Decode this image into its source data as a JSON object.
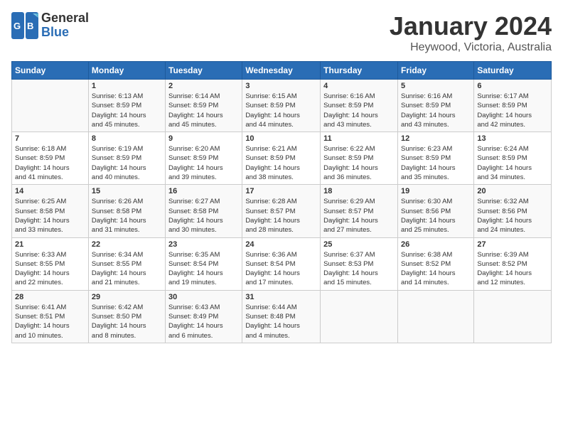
{
  "header": {
    "logo_line1": "General",
    "logo_line2": "Blue",
    "title": "January 2024",
    "subtitle": "Heywood, Victoria, Australia"
  },
  "days_of_week": [
    "Sunday",
    "Monday",
    "Tuesday",
    "Wednesday",
    "Thursday",
    "Friday",
    "Saturday"
  ],
  "weeks": [
    [
      {
        "day": "",
        "info": ""
      },
      {
        "day": "1",
        "info": "Sunrise: 6:13 AM\nSunset: 8:59 PM\nDaylight: 14 hours\nand 45 minutes."
      },
      {
        "day": "2",
        "info": "Sunrise: 6:14 AM\nSunset: 8:59 PM\nDaylight: 14 hours\nand 45 minutes."
      },
      {
        "day": "3",
        "info": "Sunrise: 6:15 AM\nSunset: 8:59 PM\nDaylight: 14 hours\nand 44 minutes."
      },
      {
        "day": "4",
        "info": "Sunrise: 6:16 AM\nSunset: 8:59 PM\nDaylight: 14 hours\nand 43 minutes."
      },
      {
        "day": "5",
        "info": "Sunrise: 6:16 AM\nSunset: 8:59 PM\nDaylight: 14 hours\nand 43 minutes."
      },
      {
        "day": "6",
        "info": "Sunrise: 6:17 AM\nSunset: 8:59 PM\nDaylight: 14 hours\nand 42 minutes."
      }
    ],
    [
      {
        "day": "7",
        "info": "Sunrise: 6:18 AM\nSunset: 8:59 PM\nDaylight: 14 hours\nand 41 minutes."
      },
      {
        "day": "8",
        "info": "Sunrise: 6:19 AM\nSunset: 8:59 PM\nDaylight: 14 hours\nand 40 minutes."
      },
      {
        "day": "9",
        "info": "Sunrise: 6:20 AM\nSunset: 8:59 PM\nDaylight: 14 hours\nand 39 minutes."
      },
      {
        "day": "10",
        "info": "Sunrise: 6:21 AM\nSunset: 8:59 PM\nDaylight: 14 hours\nand 38 minutes."
      },
      {
        "day": "11",
        "info": "Sunrise: 6:22 AM\nSunset: 8:59 PM\nDaylight: 14 hours\nand 36 minutes."
      },
      {
        "day": "12",
        "info": "Sunrise: 6:23 AM\nSunset: 8:59 PM\nDaylight: 14 hours\nand 35 minutes."
      },
      {
        "day": "13",
        "info": "Sunrise: 6:24 AM\nSunset: 8:59 PM\nDaylight: 14 hours\nand 34 minutes."
      }
    ],
    [
      {
        "day": "14",
        "info": "Sunrise: 6:25 AM\nSunset: 8:58 PM\nDaylight: 14 hours\nand 33 minutes."
      },
      {
        "day": "15",
        "info": "Sunrise: 6:26 AM\nSunset: 8:58 PM\nDaylight: 14 hours\nand 31 minutes."
      },
      {
        "day": "16",
        "info": "Sunrise: 6:27 AM\nSunset: 8:58 PM\nDaylight: 14 hours\nand 30 minutes."
      },
      {
        "day": "17",
        "info": "Sunrise: 6:28 AM\nSunset: 8:57 PM\nDaylight: 14 hours\nand 28 minutes."
      },
      {
        "day": "18",
        "info": "Sunrise: 6:29 AM\nSunset: 8:57 PM\nDaylight: 14 hours\nand 27 minutes."
      },
      {
        "day": "19",
        "info": "Sunrise: 6:30 AM\nSunset: 8:56 PM\nDaylight: 14 hours\nand 25 minutes."
      },
      {
        "day": "20",
        "info": "Sunrise: 6:32 AM\nSunset: 8:56 PM\nDaylight: 14 hours\nand 24 minutes."
      }
    ],
    [
      {
        "day": "21",
        "info": "Sunrise: 6:33 AM\nSunset: 8:55 PM\nDaylight: 14 hours\nand 22 minutes."
      },
      {
        "day": "22",
        "info": "Sunrise: 6:34 AM\nSunset: 8:55 PM\nDaylight: 14 hours\nand 21 minutes."
      },
      {
        "day": "23",
        "info": "Sunrise: 6:35 AM\nSunset: 8:54 PM\nDaylight: 14 hours\nand 19 minutes."
      },
      {
        "day": "24",
        "info": "Sunrise: 6:36 AM\nSunset: 8:54 PM\nDaylight: 14 hours\nand 17 minutes."
      },
      {
        "day": "25",
        "info": "Sunrise: 6:37 AM\nSunset: 8:53 PM\nDaylight: 14 hours\nand 15 minutes."
      },
      {
        "day": "26",
        "info": "Sunrise: 6:38 AM\nSunset: 8:52 PM\nDaylight: 14 hours\nand 14 minutes."
      },
      {
        "day": "27",
        "info": "Sunrise: 6:39 AM\nSunset: 8:52 PM\nDaylight: 14 hours\nand 12 minutes."
      }
    ],
    [
      {
        "day": "28",
        "info": "Sunrise: 6:41 AM\nSunset: 8:51 PM\nDaylight: 14 hours\nand 10 minutes."
      },
      {
        "day": "29",
        "info": "Sunrise: 6:42 AM\nSunset: 8:50 PM\nDaylight: 14 hours\nand 8 minutes."
      },
      {
        "day": "30",
        "info": "Sunrise: 6:43 AM\nSunset: 8:49 PM\nDaylight: 14 hours\nand 6 minutes."
      },
      {
        "day": "31",
        "info": "Sunrise: 6:44 AM\nSunset: 8:48 PM\nDaylight: 14 hours\nand 4 minutes."
      },
      {
        "day": "",
        "info": ""
      },
      {
        "day": "",
        "info": ""
      },
      {
        "day": "",
        "info": ""
      }
    ]
  ]
}
